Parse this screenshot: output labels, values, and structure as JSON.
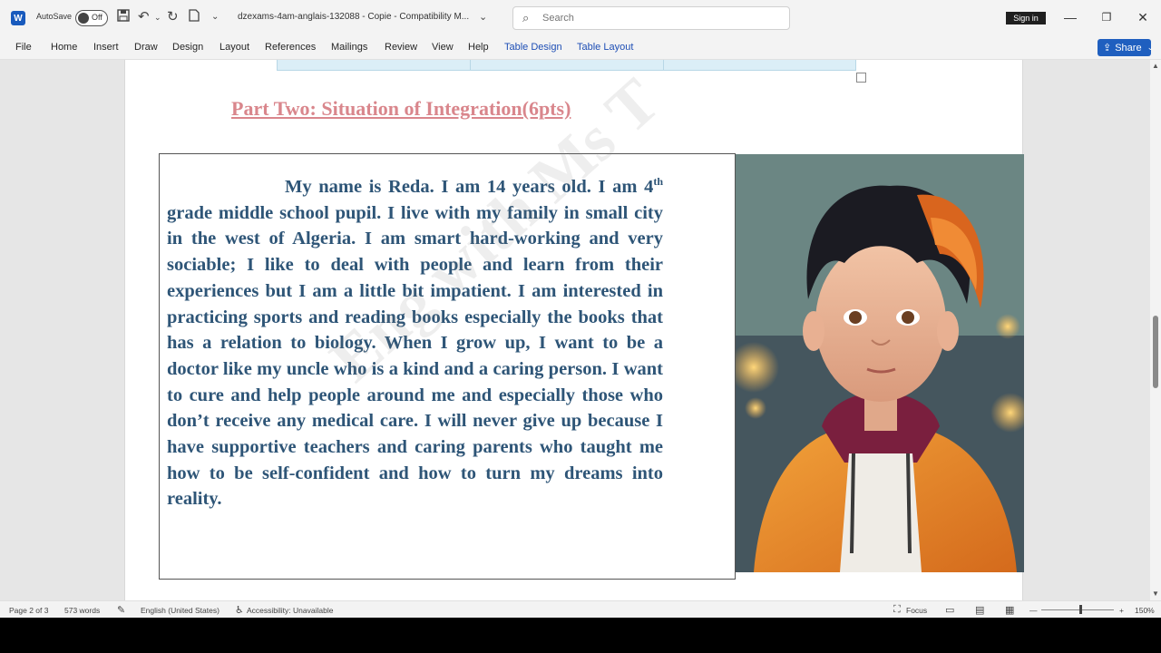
{
  "titlebar": {
    "app_icon": "W",
    "autosave_label": "AutoSave",
    "autosave_state": "Off",
    "doc_title": "dzexams-4am-anglais-132088 - Copie  -  Compatibility M...",
    "search_placeholder": "Search",
    "signin_label": "Sign in"
  },
  "ribbon": {
    "tabs": [
      "File",
      "Home",
      "Insert",
      "Draw",
      "Design",
      "Layout",
      "References",
      "Mailings",
      "Review",
      "View",
      "Help",
      "Table Design",
      "Table Layout"
    ],
    "share_label": "Share"
  },
  "document": {
    "part_title": "Part Two: Situation of Integration(6pts)",
    "para_start": "My name is Reda. I am 14 years old. I am 4",
    "para_sup": "th",
    "para_rest": " grade middle school pupil. I live with my family in small city in the west of Algeria. I am smart hard-working and very sociable; I like to deal with people and learn from their experiences but I am a little bit impatient. I am interested in practicing sports and reading books especially the books that has a relation to biology. When I grow up, I want to be a doctor like my uncle who is a kind and a caring person. I want to cure and help people around me and especially those who don’t receive any medical care. I will never give up because I have supportive teachers and caring parents who taught me how to be self-confident and how to turn my dreams into reality.",
    "watermark": "Eng with Ms T",
    "photo_alt": "Portrait of a boy with dark curly hair in an orange hoodie"
  },
  "statusbar": {
    "page": "Page 2 of 3",
    "words": "573 words",
    "language": "English (United States)",
    "accessibility": "Accessibility: Unavailable",
    "focus": "Focus",
    "zoom": "150%"
  },
  "colors": {
    "accent": "#185abd",
    "heading": "#d9868c",
    "body_text": "#2e5577"
  }
}
